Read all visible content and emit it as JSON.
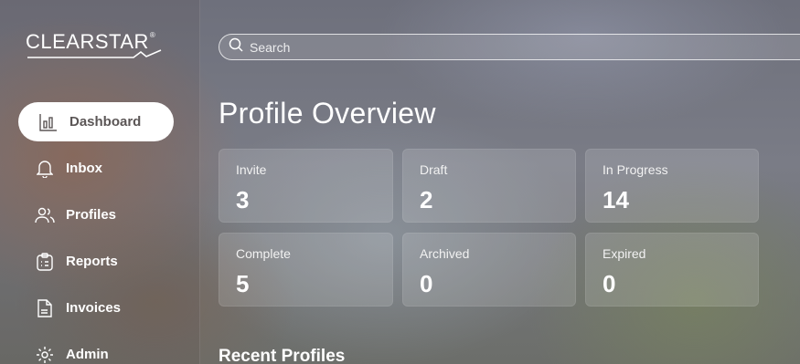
{
  "brand": {
    "name": "CLEARSTAR",
    "reg": "®"
  },
  "search": {
    "placeholder": "Search"
  },
  "nav": {
    "items": [
      {
        "label": "Dashboard",
        "icon": "bar-chart-icon",
        "active": true
      },
      {
        "label": "Inbox",
        "icon": "bell-icon"
      },
      {
        "label": "Profiles",
        "icon": "users-icon"
      },
      {
        "label": "Reports",
        "icon": "clipboard-icon"
      },
      {
        "label": "Invoices",
        "icon": "document-icon"
      },
      {
        "label": "Admin",
        "icon": "gear-icon"
      }
    ]
  },
  "overview": {
    "title": "Profile Overview",
    "cards": [
      {
        "label": "Invite",
        "value": "3"
      },
      {
        "label": "Draft",
        "value": "2"
      },
      {
        "label": "In Progress",
        "value": "14"
      },
      {
        "label": "Complete",
        "value": "5"
      },
      {
        "label": "Archived",
        "value": "0"
      },
      {
        "label": "Expired",
        "value": "0"
      }
    ]
  },
  "recent": {
    "title": "Recent Profiles"
  },
  "colors": {
    "active_nav_bg": "#ffffff",
    "active_nav_text": "#5b5656"
  }
}
